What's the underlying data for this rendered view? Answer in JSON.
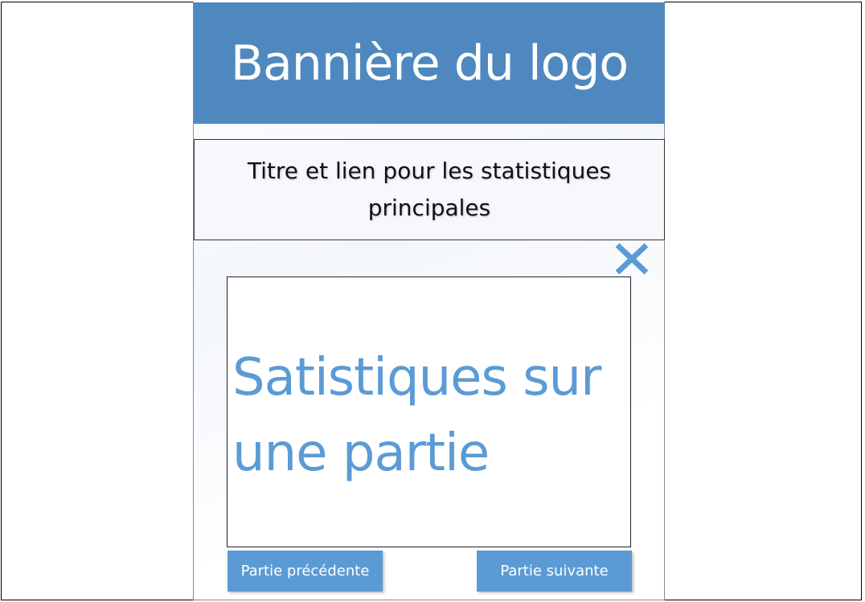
{
  "banner": {
    "text": "Bannière du logo",
    "color": "#4f88bf"
  },
  "header": {
    "title_link": "Titre et lien pour les statistiques principales"
  },
  "close_button": {
    "icon": "close-icon",
    "color": "#5b9bd5"
  },
  "main": {
    "stats_text": "Satistiques sur une partie",
    "accent_color": "#5b9bd5"
  },
  "navigation": {
    "prev_label": "Partie précédente",
    "next_label": "Partie suivante",
    "button_color": "#5b9bd5"
  }
}
